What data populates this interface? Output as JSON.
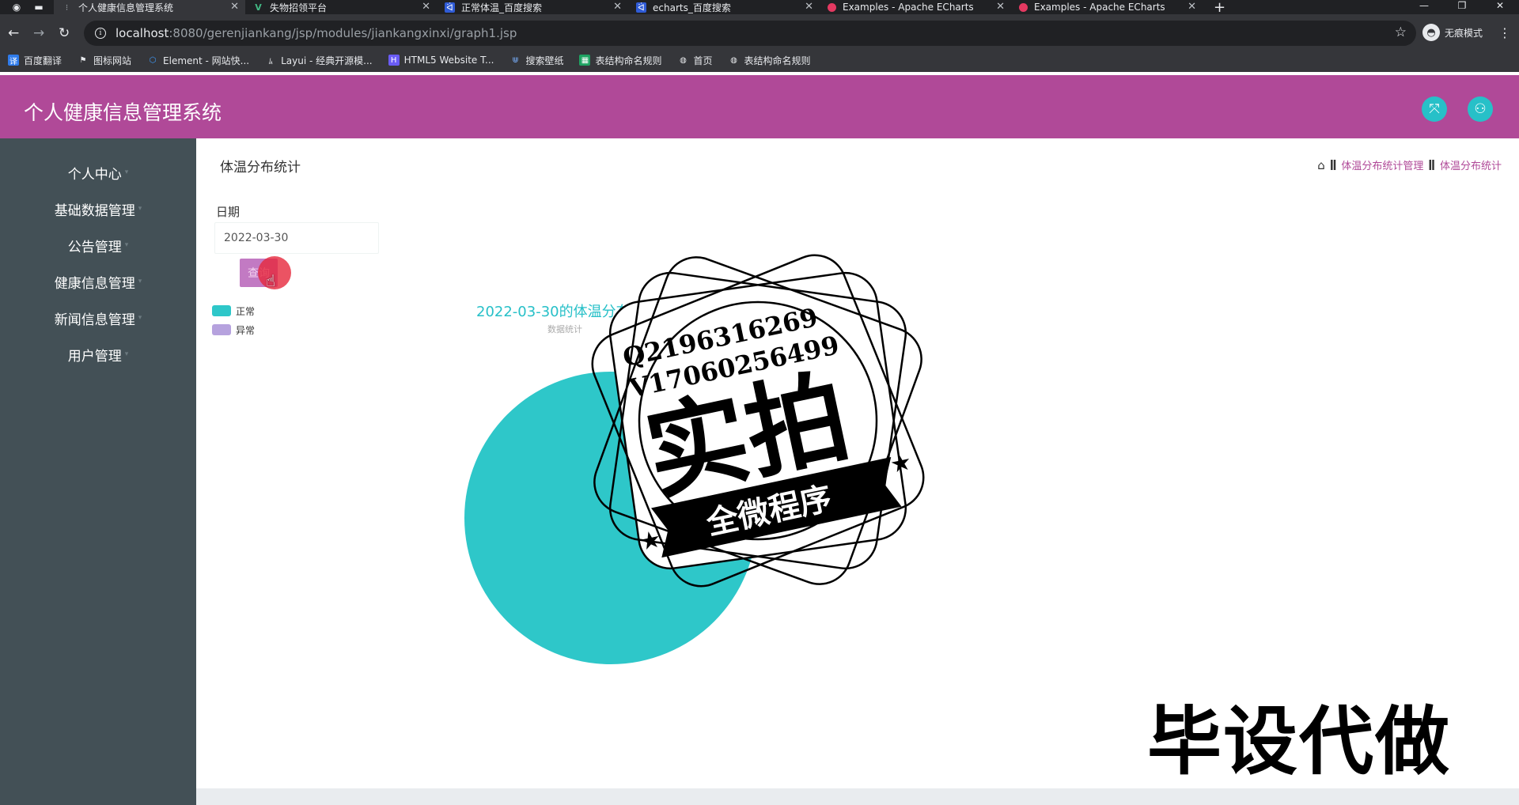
{
  "browser": {
    "tabs": [
      {
        "title": "个人健康信息管理系统",
        "active": true
      },
      {
        "title": "失物招领平台",
        "active": false
      },
      {
        "title": "正常体温_百度搜索",
        "active": false
      },
      {
        "title": "echarts_百度搜索",
        "active": false
      },
      {
        "title": "Examples - Apache ECharts",
        "active": false
      },
      {
        "title": "Examples - Apache ECharts",
        "active": false
      }
    ],
    "url_host": "localhost",
    "url_path": ":8080/gerenjiankang/jsp/modules/jiankangxinxi/graph1.jsp",
    "profile_label": "无痕模式",
    "bookmarks": [
      "百度翻译",
      "图标网站",
      "Element - 网站快...",
      "Layui - 经典开源模...",
      "HTML5 Website T...",
      "搜索壁纸",
      "表结构命名规则",
      "首页",
      "表结构命名规则"
    ]
  },
  "app": {
    "title": "个人健康信息管理系统",
    "menu": [
      "个人中心",
      "基础数据管理",
      "公告管理",
      "健康信息管理",
      "新闻信息管理",
      "用户管理"
    ],
    "page_title": "体温分布统计",
    "breadcrumb": [
      "体温分布统计管理",
      "体温分布统计"
    ],
    "date_label": "日期",
    "date_value": "2022-03-30",
    "search_label": "查询",
    "legend": [
      "正常",
      "异常"
    ],
    "colors": {
      "header": "#b04998",
      "sidebar": "#435056",
      "accent": "#27c0c8",
      "normal": "#2ec7c9",
      "abnormal": "#b6a2de"
    }
  },
  "chart_data": {
    "type": "pie",
    "title": "2022-03-30的体温分布统计",
    "subtitle": "数据统计",
    "slices": [
      {
        "name": "正常",
        "value": 100
      }
    ],
    "legend_position": "top-left"
  },
  "overlay": {
    "seal_qq": "Q2196316269",
    "seal_wx": "V17060256499",
    "seal_main": "实拍",
    "seal_banner": "全微程序",
    "corner_text": "毕设代做"
  }
}
